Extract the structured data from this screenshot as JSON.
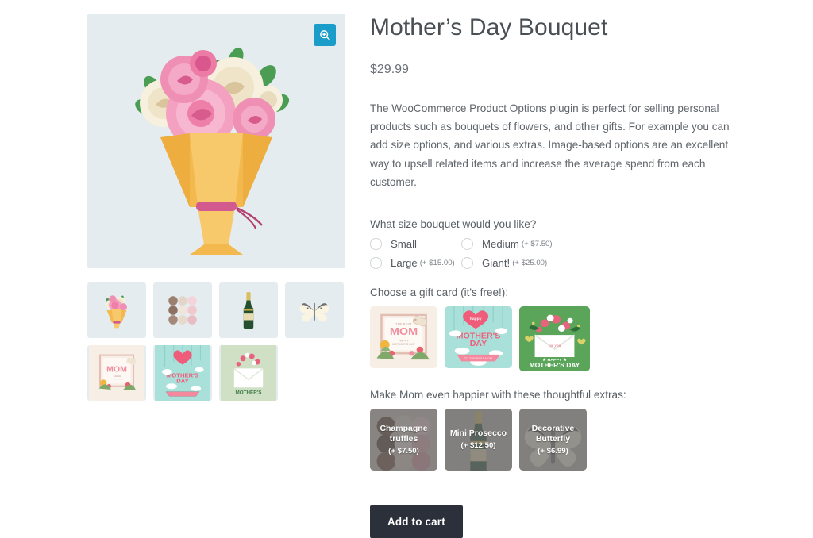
{
  "product": {
    "title": "Mother’s Day Bouquet",
    "price": "$29.99",
    "description": "The WooCommerce Product Options plugin is perfect for selling personal products such as bouquets of flowers, and other gifts. For example you can add size options, and various extras. Image-based options are an excellent way to upsell related items and increase the average spend from each customer."
  },
  "gallery": {
    "zoom_icon": "magnifier-plus-icon",
    "main_image_alt": "bouquet-of-roses",
    "thumbnails": [
      {
        "name": "bouquet",
        "selected": true
      },
      {
        "name": "chocolate-truffles",
        "selected": false
      },
      {
        "name": "champagne-bottle",
        "selected": false
      },
      {
        "name": "butterfly",
        "selected": false
      },
      {
        "name": "gift-card-mom",
        "selected": false
      },
      {
        "name": "gift-card-mothers-day-sky",
        "selected": false
      },
      {
        "name": "gift-card-envelope-green",
        "selected": false
      }
    ]
  },
  "options": {
    "size": {
      "label": "What size bouquet would you like?",
      "choices": [
        {
          "label": "Small",
          "price": "",
          "selected": false
        },
        {
          "label": "Medium",
          "price": "(+ $7.50)",
          "selected": false
        },
        {
          "label": "Large",
          "price": "(+ $15.00)",
          "selected": false
        },
        {
          "label": "Giant!",
          "price": "(+ $25.00)",
          "selected": false
        }
      ]
    },
    "gift_card": {
      "label": "Choose a gift card (it's free!):",
      "choices": [
        {
          "name": "gift-card-mom",
          "selected": false
        },
        {
          "name": "gift-card-mothers-day-sky",
          "selected": false
        },
        {
          "name": "gift-card-envelope-green",
          "selected": true
        }
      ]
    },
    "extras": {
      "label": "Make Mom even happier with these thoughtful extras:",
      "choices": [
        {
          "name": "champagne-truffles",
          "title": "Champagne truffles",
          "price": "(+ $7.50)",
          "selected": false
        },
        {
          "name": "mini-prosecco",
          "title": "Mini Prosecco",
          "price": "(+ $12.50)",
          "selected": false
        },
        {
          "name": "decorative-butterfly",
          "title": "Decorative Butterfly",
          "price": "(+ $6.99)",
          "selected": false
        }
      ]
    }
  },
  "actions": {
    "add_to_cart": "Add to cart"
  },
  "colors": {
    "image_bg": "#e4ecef",
    "zoom_button": "#1b9dc9",
    "add_to_cart_bg": "#2b303a",
    "card_green": "#5aa55a",
    "card_mint": "#a9e0da",
    "card_cream": "#f7eee6"
  }
}
